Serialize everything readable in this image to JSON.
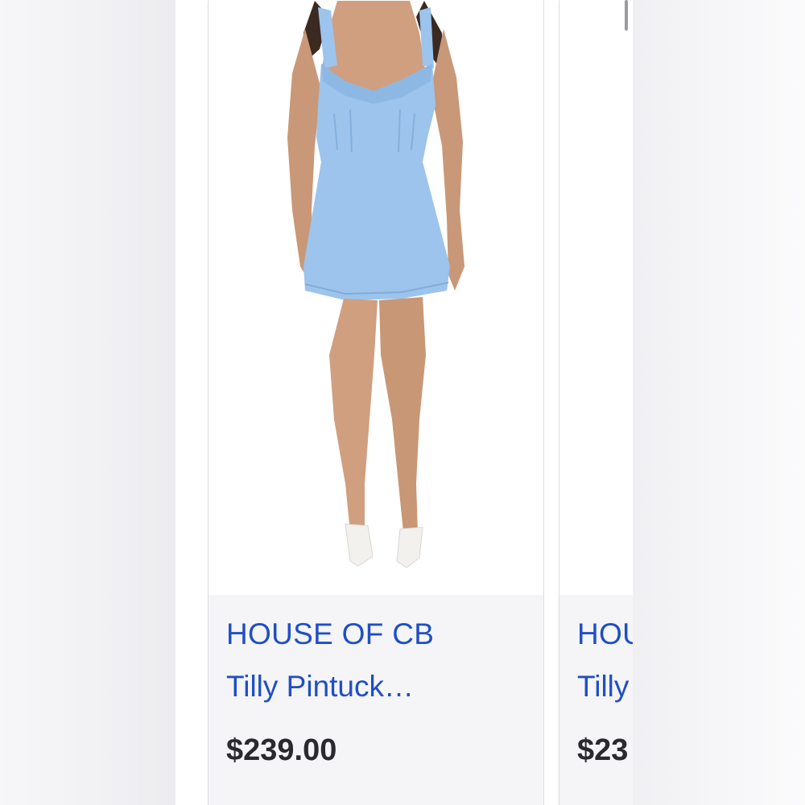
{
  "colors": {
    "link_blue": "#1f4fc4",
    "price_text": "#2a2a2e",
    "dress_blue": "#9cc4ec",
    "card_border": "#dcdde1",
    "info_bg": "#f5f5f7"
  },
  "cards": [
    {
      "brand": "HOUSE OF CB",
      "title": "Tilly Pintuck…",
      "price": "$239.00",
      "image": "product-photo-model-blue-mini-dress"
    },
    {
      "brand": "HOU",
      "title": "Tilly",
      "price": "$23",
      "image": "product-photo-partial"
    }
  ]
}
